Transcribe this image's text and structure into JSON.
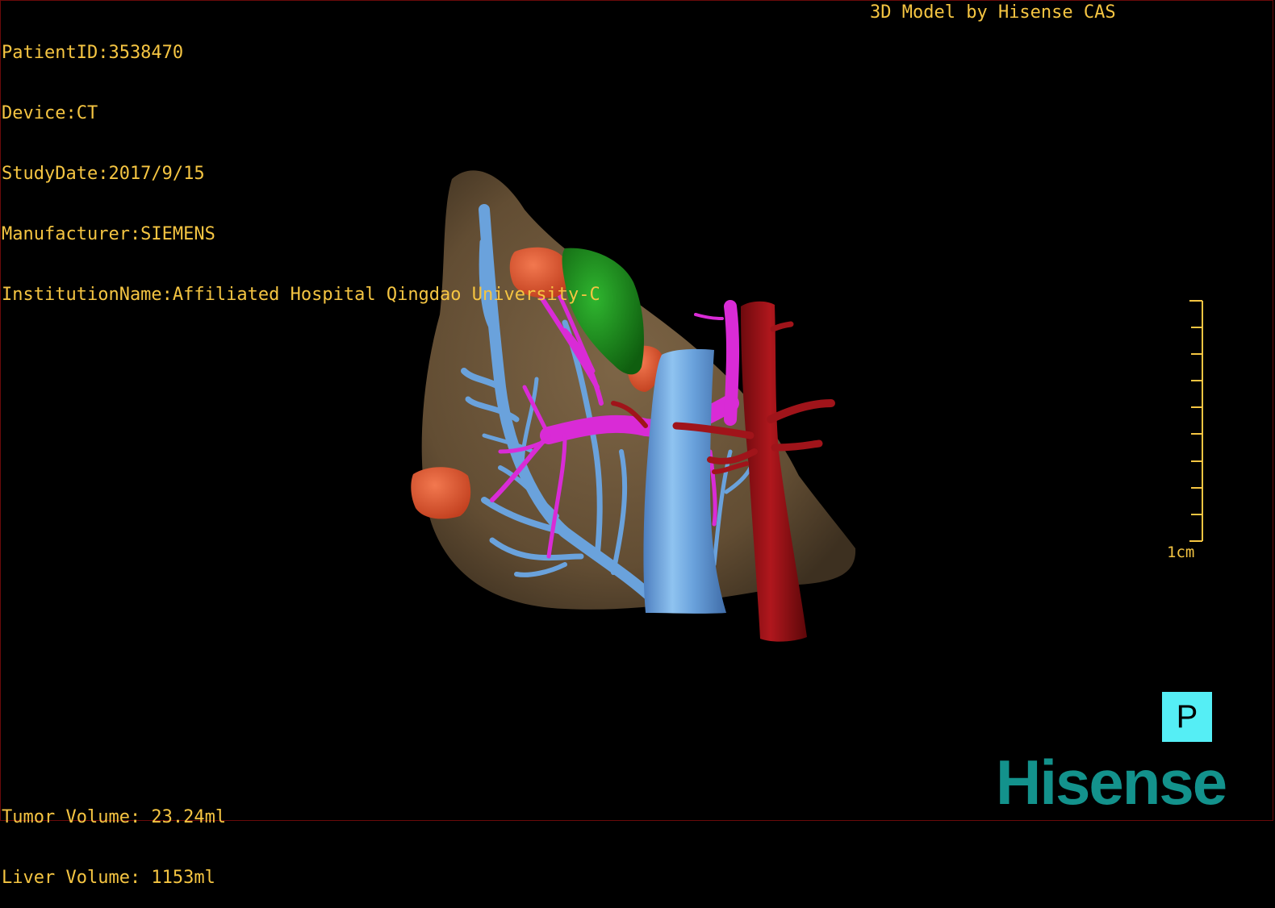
{
  "patient_info": {
    "patient_id": "PatientID:3538470",
    "device": "Device:CT",
    "study_date": "StudyDate:2017/9/15",
    "manufacturer": "Manufacturer:SIEMENS",
    "institution": "InstitutionName:Affiliated Hospital Qingdao University-C"
  },
  "credit": "3D Model by Hisense CAS",
  "volumes": {
    "tumor": "Tumor Volume: 23.24ml",
    "liver": "Liver Volume: 1153ml"
  },
  "scale_bar": {
    "label": "1cm"
  },
  "view_button": {
    "label": "P"
  },
  "logo": {
    "text": "Hisense"
  },
  "colors": {
    "overlay_text": "#f5c542",
    "liver": "#6b5538",
    "portal_vein": "#6aa2dc",
    "hepatic_vein": "#d92bd6",
    "artery": "#a0141a",
    "tumor": "#e35b34",
    "gallbladder": "#1e8a1e",
    "view_button": "#55eef5",
    "logo": "#13928c"
  }
}
